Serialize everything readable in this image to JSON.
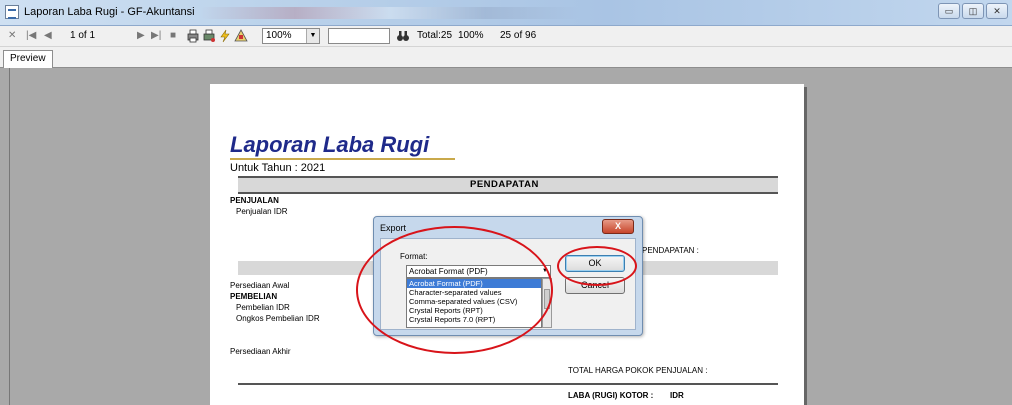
{
  "window": {
    "title": "Laporan Laba Rugi - GF-Akuntansi",
    "minimize_glyph": "▭",
    "maximize_glyph": "◫",
    "close_glyph": "✕"
  },
  "toolbar": {
    "close_glyph": "✕",
    "first_glyph": "|◀",
    "prev_glyph": "◀",
    "page_of": "1 of 1",
    "next_glyph": "▶",
    "last_glyph": "▶|",
    "stop_glyph": "■",
    "zoom_value": "100%",
    "total": "Total:25",
    "percent": "100%",
    "count": "25 of 96"
  },
  "tabs": [
    {
      "label": "Preview"
    }
  ],
  "report": {
    "title": "Laporan Laba Rugi",
    "subtitle": "Untuk Tahun : 2021",
    "section_header": "PENDAPATAN",
    "penjualan_header": "PENJUALAN",
    "penjualan_idr": "Penjualan IDR",
    "total_pendapatan_label": "PENDAPATAN :",
    "persediaan_awal": "Persediaan Awal",
    "pembelian_header": "PEMBELIAN",
    "pembelian_idr": "Pembelian IDR",
    "ongkos_pembelian": "Ongkos Pembelian IDR",
    "persediaan_akhir": "Persediaan Akhir",
    "total_hpp": "TOTAL HARGA POKOK PENJUALAN :",
    "laba_kotor": "LABA (RUGI) KOTOR :",
    "currency": "IDR"
  },
  "export_dialog": {
    "title": "Export",
    "close_glyph": "X",
    "format_label": "Format:",
    "selected_format": "Acrobat Format (PDF)",
    "options": [
      "Acrobat Format (PDF)",
      "Character-separated values",
      "Comma-separated values (CSV)",
      "Crystal Reports (RPT)",
      "Crystal Reports 7.0 (RPT)"
    ],
    "ok_label": "OK",
    "cancel_label": "Cancel"
  },
  "colors": {
    "report_title": "#1f2a8a",
    "annotation_ring": "#d8141a",
    "list_selection": "#3d7bd6"
  }
}
